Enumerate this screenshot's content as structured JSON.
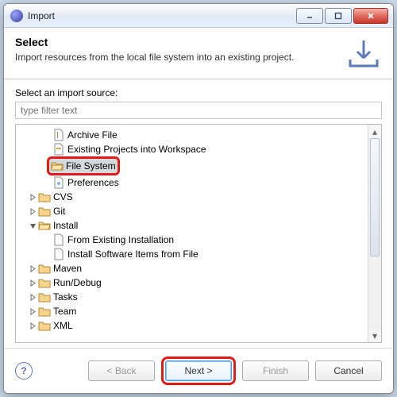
{
  "window": {
    "title": "Import"
  },
  "header": {
    "title": "Select",
    "desc": "Import resources from the local file system into an existing project."
  },
  "body": {
    "sourceLabel": "Select an import source:",
    "filterPlaceholder": "type filter text"
  },
  "tree": {
    "archive": "Archive File",
    "existing": "Existing Projects into Workspace",
    "fileSystem": "File System",
    "preferences": "Preferences",
    "cvs": "CVS",
    "git": "Git",
    "install": "Install",
    "installFromExisting": "From Existing Installation",
    "installFromFile": "Install Software Items from File",
    "maven": "Maven",
    "runDebug": "Run/Debug",
    "tasks": "Tasks",
    "team": "Team",
    "xml": "XML"
  },
  "footer": {
    "back": "< Back",
    "next": "Next >",
    "finish": "Finish",
    "cancel": "Cancel"
  }
}
